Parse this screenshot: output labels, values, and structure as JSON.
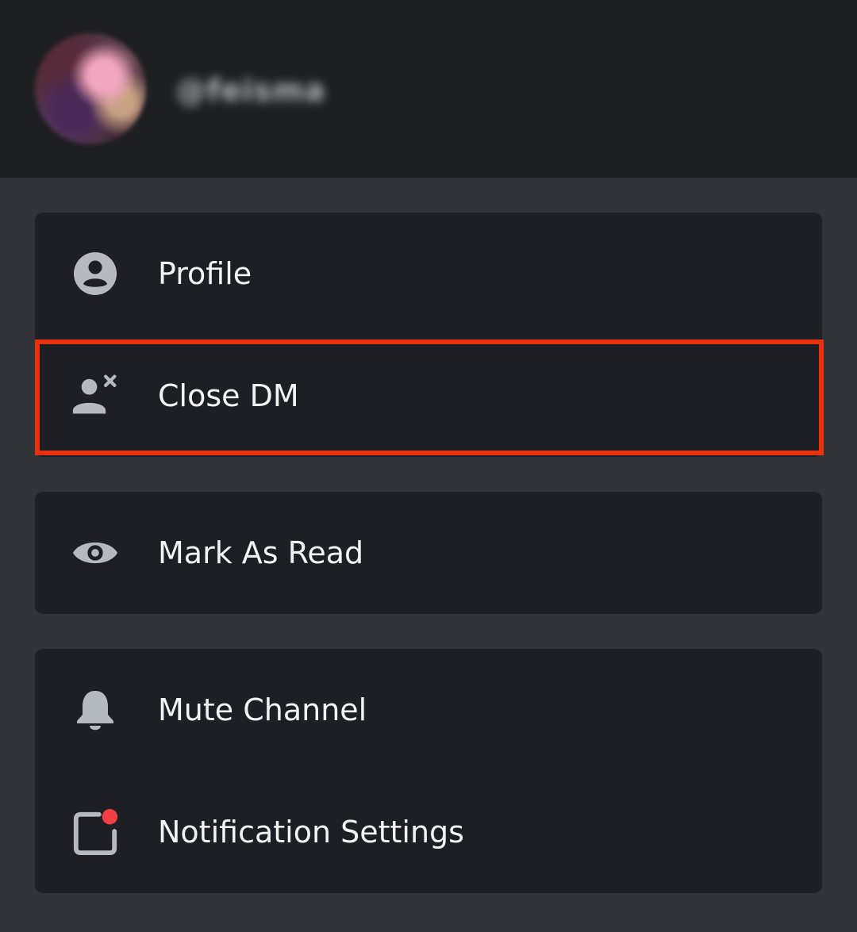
{
  "header": {
    "username": "@feisma"
  },
  "menu": {
    "groups": [
      {
        "items": [
          {
            "label": "Profile",
            "icon": "profile-icon"
          },
          {
            "label": "Close DM",
            "icon": "close-dm-icon"
          }
        ]
      },
      {
        "items": [
          {
            "label": "Mark As Read",
            "icon": "eye-icon"
          }
        ]
      },
      {
        "items": [
          {
            "label": "Mute Channel",
            "icon": "bell-icon"
          },
          {
            "label": "Notification Settings",
            "icon": "notification-settings-icon"
          }
        ]
      }
    ]
  },
  "colors": {
    "header_bg": "#1e1f22",
    "page_bg": "#313338",
    "group_bg": "#1e1f24",
    "icon": "#b5bac1",
    "text": "#f2f3f5",
    "highlight": "#e8320e",
    "notification_dot": "#f23f43"
  }
}
